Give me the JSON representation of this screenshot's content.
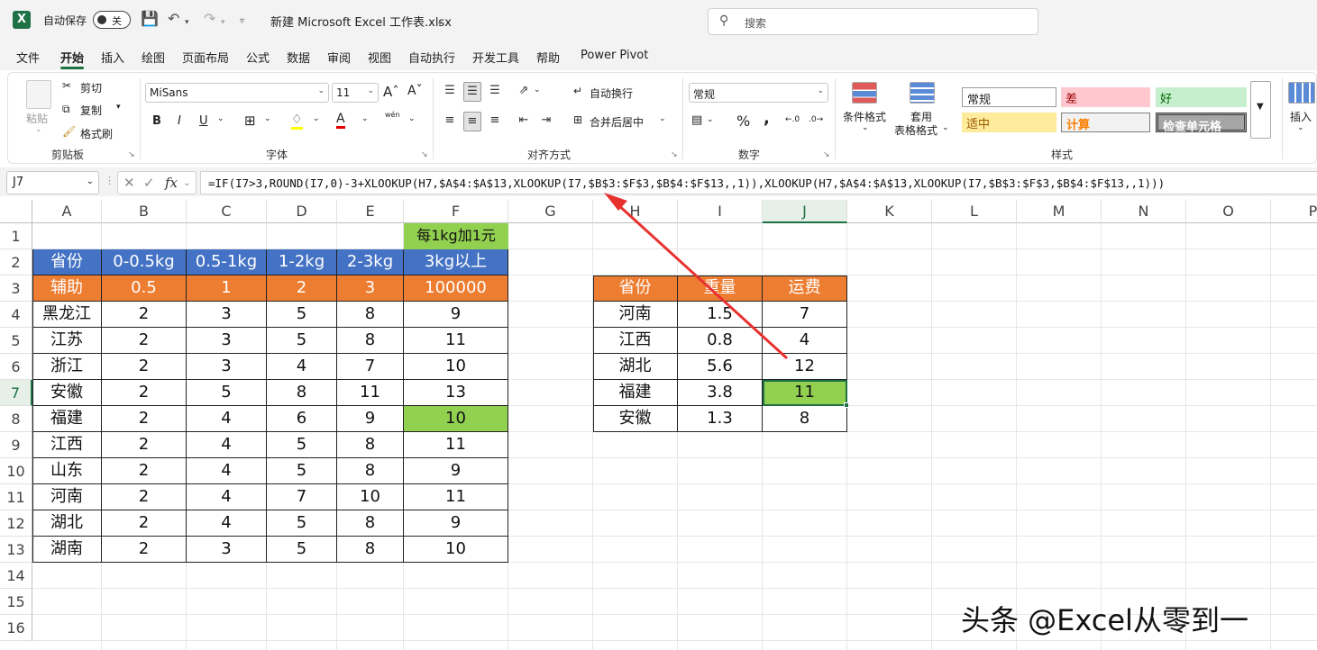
{
  "titlebar": {
    "autosave_label": "自动保存",
    "autosave_state": "关",
    "filename": "新建 Microsoft Excel 工作表.xlsx",
    "search_placeholder": "搜索"
  },
  "menu_tabs": [
    "文件",
    "开始",
    "插入",
    "绘图",
    "页面布局",
    "公式",
    "数据",
    "审阅",
    "视图",
    "自动执行",
    "开发工具",
    "帮助",
    "Power Pivot"
  ],
  "active_tab": "开始",
  "ribbon": {
    "clipboard": {
      "paste": "粘贴",
      "cut": "剪切",
      "copy": "复制",
      "format_painter": "格式刷",
      "group": "剪贴板"
    },
    "font": {
      "name": "MiSans",
      "size": "11",
      "bold": "B",
      "italic": "I",
      "underline": "U",
      "group": "字体",
      "pinyin": "wén"
    },
    "alignment": {
      "wrap": "自动换行",
      "merge": "合并后居中",
      "group": "对齐方式"
    },
    "number": {
      "format": "常规",
      "group": "数字",
      "percent": "%",
      "comma": ","
    },
    "styles": {
      "cond_format": "条件格式",
      "table_format_1": "套用",
      "table_format_2": "表格格式",
      "normal": "常规",
      "bad": "差",
      "good": "好",
      "neutral": "适中",
      "calc": "计算",
      "check": "检查单元格",
      "group": "样式"
    },
    "insert": "插入"
  },
  "formula_bar": {
    "name_box": "J7",
    "fx": "fx",
    "formula": "=IF(I7>3,ROUND(I7,0)-3+XLOOKUP(H7,$A$4:$A$13,XLOOKUP(I7,$B$3:$F$3,$B$4:$F$13,,1)),XLOOKUP(H7,$A$4:$A$13,XLOOKUP(I7,$B$3:$F$3,$B$4:$F$13,,1)))"
  },
  "columns": [
    "A",
    "B",
    "C",
    "D",
    "E",
    "F",
    "G",
    "H",
    "I",
    "J",
    "K",
    "L",
    "M",
    "N",
    "O",
    "P"
  ],
  "rows": [
    "1",
    "2",
    "3",
    "4",
    "5",
    "6",
    "7",
    "8",
    "9",
    "10",
    "11",
    "12",
    "13",
    "14",
    "15",
    "16"
  ],
  "selected_cell": {
    "col": "J",
    "row": "7"
  },
  "rate_table": {
    "note": "每1kg加1元",
    "header": [
      "省份",
      "0-0.5kg",
      "0.5-1kg",
      "1-2kg",
      "2-3kg",
      "3kg以上"
    ],
    "helper": [
      "辅助",
      "0.5",
      "1",
      "2",
      "3",
      "100000"
    ],
    "rows": [
      [
        "黑龙江",
        "2",
        "3",
        "5",
        "8",
        "9"
      ],
      [
        "江苏",
        "2",
        "3",
        "5",
        "8",
        "11"
      ],
      [
        "浙江",
        "2",
        "3",
        "4",
        "7",
        "10"
      ],
      [
        "安徽",
        "2",
        "5",
        "8",
        "11",
        "13"
      ],
      [
        "福建",
        "2",
        "4",
        "6",
        "9",
        "10"
      ],
      [
        "江西",
        "2",
        "4",
        "5",
        "8",
        "11"
      ],
      [
        "山东",
        "2",
        "4",
        "5",
        "8",
        "9"
      ],
      [
        "河南",
        "2",
        "4",
        "7",
        "10",
        "11"
      ],
      [
        "湖北",
        "2",
        "4",
        "5",
        "8",
        "9"
      ],
      [
        "湖南",
        "2",
        "3",
        "5",
        "8",
        "10"
      ]
    ]
  },
  "lookup_table": {
    "header": [
      "省份",
      "重量",
      "运费"
    ],
    "rows": [
      [
        "河南",
        "1.5",
        "7"
      ],
      [
        "江西",
        "0.8",
        "4"
      ],
      [
        "湖北",
        "5.6",
        "12"
      ],
      [
        "福建",
        "3.8",
        "11"
      ],
      [
        "安徽",
        "1.3",
        "8"
      ]
    ]
  },
  "watermark": "头条 @Excel从零到一",
  "colors": {
    "excel_green": "#1e7145",
    "header_blue": "#4472c4",
    "header_orange": "#ed7d31",
    "highlight_green": "#92d050",
    "arrow_red": "#e8312f"
  }
}
